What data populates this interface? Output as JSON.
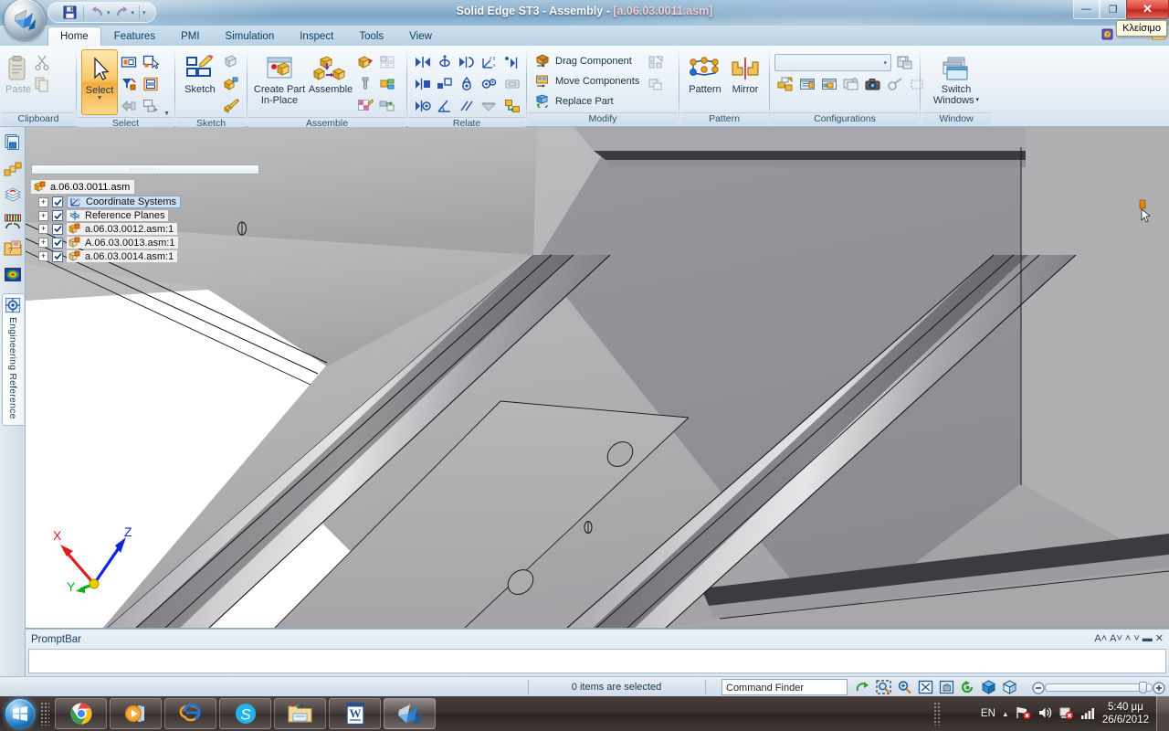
{
  "window": {
    "title_app": "Solid Edge ST3 - Assembly - ",
    "title_file": "[a.06.03.0011.asm]",
    "close_tooltip": "Κλείσιμο",
    "minimize_glyph": "—",
    "restore_glyph": "❐",
    "close_glyph": "✕",
    "inner_minimize": "—",
    "inner_restore": "▭",
    "inner_close": "▲"
  },
  "qat": {
    "save_label": "save-icon",
    "undo_label": "undo-icon",
    "redo_label": "redo-icon",
    "more_label": "▾"
  },
  "ribbon": {
    "tabs": [
      {
        "label": "Home",
        "active": true
      },
      {
        "label": "Features",
        "active": false
      },
      {
        "label": "PMI",
        "active": false
      },
      {
        "label": "Simulation",
        "active": false
      },
      {
        "label": "Inspect",
        "active": false
      },
      {
        "label": "Tools",
        "active": false
      },
      {
        "label": "View",
        "active": false
      }
    ],
    "groups": {
      "clipboard": {
        "label": "Clipboard",
        "paste_label": "Paste",
        "cut_label": "Cut",
        "copy_label": "Copy"
      },
      "select": {
        "label": "Select",
        "select_label": "Select",
        "items": [
          "select-set-icon",
          "select-rubberband-icon",
          "select-filter-icon",
          "select-group-icon",
          "select-similar-icon",
          "select-tools-icon"
        ]
      },
      "sketch": {
        "label": "Sketch",
        "sketch_label": "Sketch",
        "items": [
          "sketch-copy-icon",
          "sketch-project-icon",
          "sketch-edit-icon"
        ]
      },
      "assemble": {
        "label": "Assemble",
        "create_part_label": "Create Part\nIn-Place",
        "create_part_line1": "Create Part",
        "create_part_line2": "In-Place",
        "assemble_label": "Assemble",
        "items": [
          "capture-fit-icon",
          "assembly-pattern-icon",
          "fastener-icon",
          "adjust-part-icon",
          "part-paint-icon",
          "disperse-icon"
        ]
      },
      "relate": {
        "label": "Relate",
        "items": [
          "mate-icon",
          "axial-align-icon",
          "planar-align-icon",
          "ground-icon",
          "flush-icon",
          "connect-icon",
          "cam-icon",
          "gear-icon",
          "insert-icon",
          "angle-icon",
          "parallel-icon",
          "tangent-icon",
          "assemble-relate-icon",
          "relationship-assistant-icon",
          "peer-relate-icon"
        ]
      },
      "modify": {
        "label": "Modify",
        "drag_component_label": "Drag Component",
        "move_components_label": "Move Components",
        "replace_part_label": "Replace Part",
        "extra_icons": [
          "pattern-move-icon",
          "undo-move-icon"
        ]
      },
      "pattern": {
        "label": "Pattern",
        "pattern_label": "Pattern",
        "mirror_label": "Mirror"
      },
      "configurations": {
        "label": "Configurations",
        "combo_value": "",
        "combo_caret": "▾",
        "save_config_icon": "save-configuration-icon",
        "items": [
          "display-configuration-icon",
          "zones-icon",
          "alternate-assembly-icon",
          "view-styles-icon",
          "camera-icon",
          "explode-icon",
          "select-region-icon"
        ]
      },
      "window": {
        "label": "Window",
        "switch_line1": "Switch",
        "switch_line2": "Windows ",
        "switch_caret": "▾"
      }
    }
  },
  "dockbar": {
    "buttons": [
      "assembly-pathfinder-icon",
      "parts-library-icon",
      "layers-icon",
      "sensors-icon",
      "family-of-assemblies-icon",
      "thermal-results-icon"
    ],
    "active_tab_label": "Engineering Reference",
    "active_tab_icon": "engineering-reference-icon"
  },
  "tree": {
    "grip_dots": "··········",
    "root": {
      "label": "a.06.03.0011.asm",
      "icon": "assembly-icon"
    },
    "nodes": [
      {
        "label": "Coordinate Systems",
        "icon": "coordinate-systems-icon",
        "checked": true,
        "expander": "+",
        "selected": true
      },
      {
        "label": "Reference Planes",
        "icon": "reference-planes-icon",
        "checked": true,
        "expander": "+",
        "selected": false
      },
      {
        "label": "a.06.03.0012.asm:1",
        "icon": "assembly-icon",
        "checked": true,
        "expander": "+",
        "selected": false
      },
      {
        "label": "A.06.03.0013.asm:1",
        "icon": "subassembly-icon",
        "checked": true,
        "expander": "+",
        "selected": false
      },
      {
        "label": "a.06.03.0014.asm:1",
        "icon": "subassembly-icon",
        "checked": true,
        "expander": "+",
        "selected": false
      }
    ],
    "check_glyph": "✔"
  },
  "viewport": {
    "triad": {
      "x_label": "X",
      "y_label": "Y",
      "z_label": "Z"
    },
    "colors": {
      "x_axis": "#e01b1b",
      "y_axis": "#12b012",
      "z_axis": "#1024e0",
      "origin": "#e8d000",
      "background": "#ffffff",
      "face_light": "#b4b4b4",
      "face_mid": "#9b9b9f",
      "face_dark": "#808086",
      "edge": "#1a1a1a"
    }
  },
  "promptbar": {
    "label": "PromptBar",
    "input_value": "",
    "tools": [
      "A˄",
      "A˅",
      "˄",
      "˅",
      "▬",
      "✕"
    ]
  },
  "statusbar": {
    "selection_text": "0 items are selected",
    "command_finder_value": "Command Finder",
    "icons": [
      "redo-view-icon",
      "zoom-area-icon",
      "zoom-icon",
      "fit-icon",
      "pan-icon",
      "rotate-icon",
      "common-views-icon",
      "view-orientation-icon"
    ],
    "zoom_minus": "–",
    "zoom_plus": "+"
  },
  "taskbar": {
    "start_label": "start-orb-icon",
    "items": [
      {
        "icon": "chrome-icon",
        "active": false
      },
      {
        "icon": "media-player-icon",
        "active": false
      },
      {
        "icon": "internet-explorer-icon",
        "active": false
      },
      {
        "icon": "skype-icon",
        "active": false
      },
      {
        "icon": "file-explorer-icon",
        "active": false
      },
      {
        "icon": "word-icon",
        "active": false
      },
      {
        "icon": "solid-edge-icon",
        "active": true
      }
    ],
    "tray": {
      "language": "EN",
      "show_hidden_glyph": "▲",
      "icons": [
        "network-error-icon",
        "volume-icon",
        "action-center-error-icon",
        "signal-icon"
      ],
      "time": "5:40 μμ",
      "date": "26/6/2012"
    }
  }
}
